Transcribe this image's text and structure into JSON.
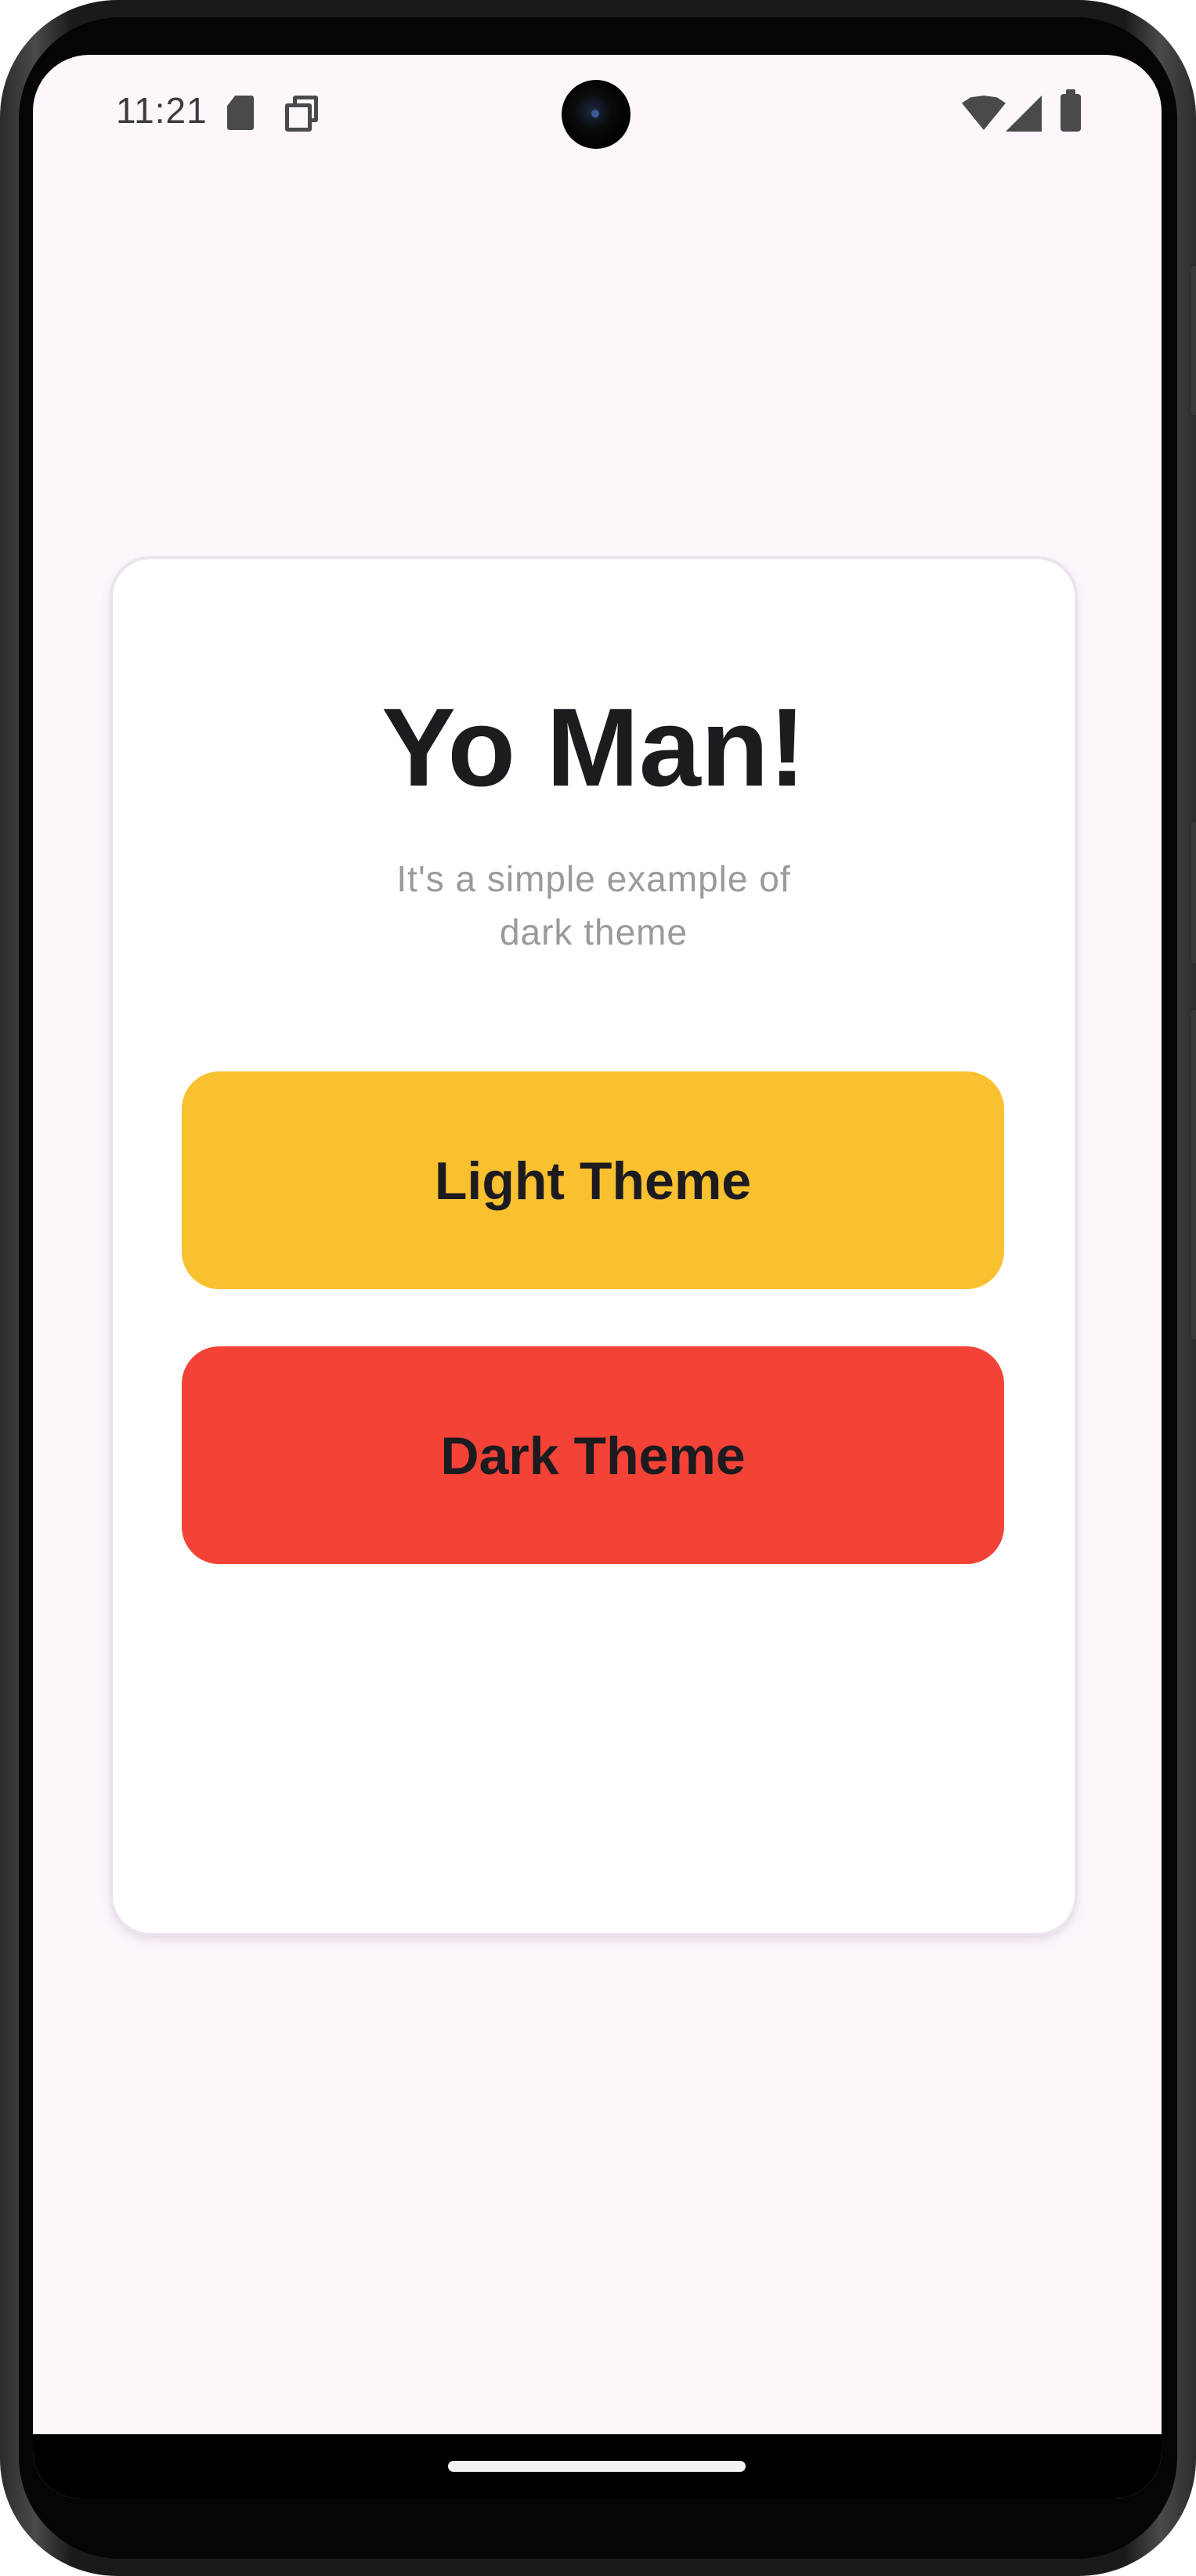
{
  "status_bar": {
    "time": "11:21",
    "icons": [
      "sd-card-icon",
      "copy-icon",
      "wifi-icon",
      "cell-signal-icon",
      "battery-icon"
    ]
  },
  "card": {
    "title": "Yo Man!",
    "subtitle": "It's a simple example of dark theme"
  },
  "buttons": {
    "light_label": "Light Theme",
    "dark_label": "Dark Theme"
  },
  "colors": {
    "background": "#fdf6fd",
    "card": "#ffffff",
    "light_button": "#f9c02f",
    "dark_button": "#f44336",
    "text": "#1c1b1f",
    "subtitle_text": "#9a9a9a"
  }
}
